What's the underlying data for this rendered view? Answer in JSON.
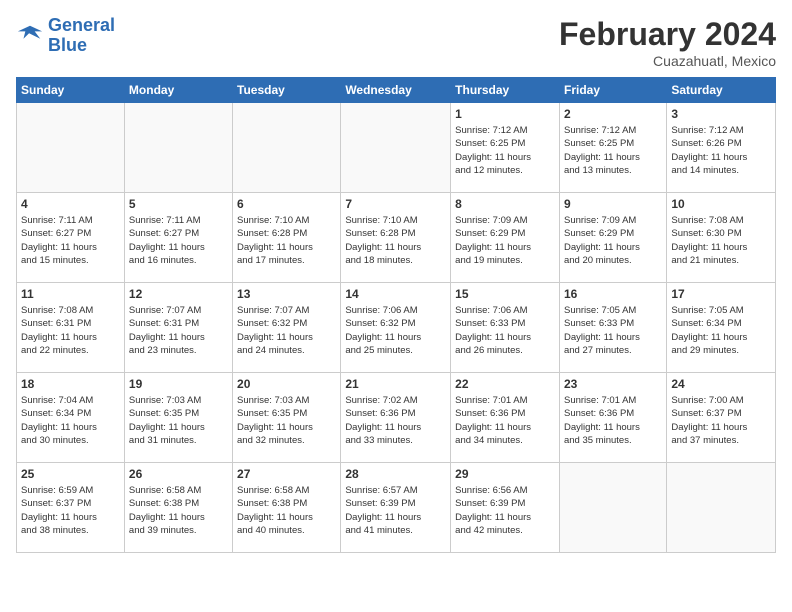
{
  "header": {
    "logo_line1": "General",
    "logo_line2": "Blue",
    "month_year": "February 2024",
    "location": "Cuazahuatl, Mexico"
  },
  "days_of_week": [
    "Sunday",
    "Monday",
    "Tuesday",
    "Wednesday",
    "Thursday",
    "Friday",
    "Saturday"
  ],
  "weeks": [
    [
      {
        "day": "",
        "info": ""
      },
      {
        "day": "",
        "info": ""
      },
      {
        "day": "",
        "info": ""
      },
      {
        "day": "",
        "info": ""
      },
      {
        "day": "1",
        "info": "Sunrise: 7:12 AM\nSunset: 6:25 PM\nDaylight: 11 hours\nand 12 minutes."
      },
      {
        "day": "2",
        "info": "Sunrise: 7:12 AM\nSunset: 6:25 PM\nDaylight: 11 hours\nand 13 minutes."
      },
      {
        "day": "3",
        "info": "Sunrise: 7:12 AM\nSunset: 6:26 PM\nDaylight: 11 hours\nand 14 minutes."
      }
    ],
    [
      {
        "day": "4",
        "info": "Sunrise: 7:11 AM\nSunset: 6:27 PM\nDaylight: 11 hours\nand 15 minutes."
      },
      {
        "day": "5",
        "info": "Sunrise: 7:11 AM\nSunset: 6:27 PM\nDaylight: 11 hours\nand 16 minutes."
      },
      {
        "day": "6",
        "info": "Sunrise: 7:10 AM\nSunset: 6:28 PM\nDaylight: 11 hours\nand 17 minutes."
      },
      {
        "day": "7",
        "info": "Sunrise: 7:10 AM\nSunset: 6:28 PM\nDaylight: 11 hours\nand 18 minutes."
      },
      {
        "day": "8",
        "info": "Sunrise: 7:09 AM\nSunset: 6:29 PM\nDaylight: 11 hours\nand 19 minutes."
      },
      {
        "day": "9",
        "info": "Sunrise: 7:09 AM\nSunset: 6:29 PM\nDaylight: 11 hours\nand 20 minutes."
      },
      {
        "day": "10",
        "info": "Sunrise: 7:08 AM\nSunset: 6:30 PM\nDaylight: 11 hours\nand 21 minutes."
      }
    ],
    [
      {
        "day": "11",
        "info": "Sunrise: 7:08 AM\nSunset: 6:31 PM\nDaylight: 11 hours\nand 22 minutes."
      },
      {
        "day": "12",
        "info": "Sunrise: 7:07 AM\nSunset: 6:31 PM\nDaylight: 11 hours\nand 23 minutes."
      },
      {
        "day": "13",
        "info": "Sunrise: 7:07 AM\nSunset: 6:32 PM\nDaylight: 11 hours\nand 24 minutes."
      },
      {
        "day": "14",
        "info": "Sunrise: 7:06 AM\nSunset: 6:32 PM\nDaylight: 11 hours\nand 25 minutes."
      },
      {
        "day": "15",
        "info": "Sunrise: 7:06 AM\nSunset: 6:33 PM\nDaylight: 11 hours\nand 26 minutes."
      },
      {
        "day": "16",
        "info": "Sunrise: 7:05 AM\nSunset: 6:33 PM\nDaylight: 11 hours\nand 27 minutes."
      },
      {
        "day": "17",
        "info": "Sunrise: 7:05 AM\nSunset: 6:34 PM\nDaylight: 11 hours\nand 29 minutes."
      }
    ],
    [
      {
        "day": "18",
        "info": "Sunrise: 7:04 AM\nSunset: 6:34 PM\nDaylight: 11 hours\nand 30 minutes."
      },
      {
        "day": "19",
        "info": "Sunrise: 7:03 AM\nSunset: 6:35 PM\nDaylight: 11 hours\nand 31 minutes."
      },
      {
        "day": "20",
        "info": "Sunrise: 7:03 AM\nSunset: 6:35 PM\nDaylight: 11 hours\nand 32 minutes."
      },
      {
        "day": "21",
        "info": "Sunrise: 7:02 AM\nSunset: 6:36 PM\nDaylight: 11 hours\nand 33 minutes."
      },
      {
        "day": "22",
        "info": "Sunrise: 7:01 AM\nSunset: 6:36 PM\nDaylight: 11 hours\nand 34 minutes."
      },
      {
        "day": "23",
        "info": "Sunrise: 7:01 AM\nSunset: 6:36 PM\nDaylight: 11 hours\nand 35 minutes."
      },
      {
        "day": "24",
        "info": "Sunrise: 7:00 AM\nSunset: 6:37 PM\nDaylight: 11 hours\nand 37 minutes."
      }
    ],
    [
      {
        "day": "25",
        "info": "Sunrise: 6:59 AM\nSunset: 6:37 PM\nDaylight: 11 hours\nand 38 minutes."
      },
      {
        "day": "26",
        "info": "Sunrise: 6:58 AM\nSunset: 6:38 PM\nDaylight: 11 hours\nand 39 minutes."
      },
      {
        "day": "27",
        "info": "Sunrise: 6:58 AM\nSunset: 6:38 PM\nDaylight: 11 hours\nand 40 minutes."
      },
      {
        "day": "28",
        "info": "Sunrise: 6:57 AM\nSunset: 6:39 PM\nDaylight: 11 hours\nand 41 minutes."
      },
      {
        "day": "29",
        "info": "Sunrise: 6:56 AM\nSunset: 6:39 PM\nDaylight: 11 hours\nand 42 minutes."
      },
      {
        "day": "",
        "info": ""
      },
      {
        "day": "",
        "info": ""
      }
    ]
  ]
}
